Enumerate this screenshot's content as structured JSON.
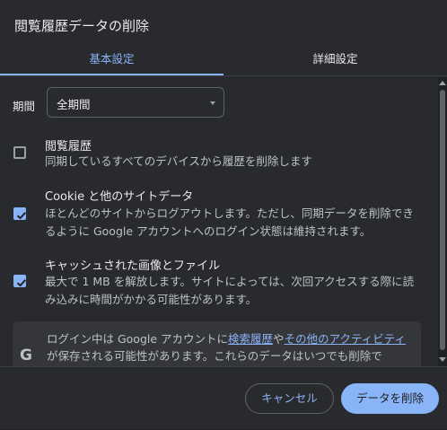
{
  "dialog": {
    "title": "閲覧履歴データの削除",
    "tabs": {
      "basic": "基本設定",
      "advanced": "詳細設定"
    },
    "time_range": {
      "label": "期間",
      "value": "全期間"
    },
    "items": [
      {
        "title": "閲覧履歴",
        "description": "同期しているすべてのデバイスから履歴を削除します",
        "checked": false
      },
      {
        "title": "Cookie と他のサイトデータ",
        "description": "ほとんどのサイトからログアウトします。ただし、同期データを削除できるように Google アカウントへのログイン状態は維持されます。",
        "checked": true
      },
      {
        "title": "キャッシュされた画像とファイル",
        "description": "最大で 1 MB を解放します。サイトによっては、次回アクセスする際に読み込みに時間がかかる可能性があります。",
        "checked": true
      }
    ],
    "google_notice": {
      "icon": "G",
      "text_before": "ログイン中は Google アカウントに",
      "link1": "検索履歴",
      "text_middle": "や",
      "link2": "その他のアクティビティ",
      "text_after": "が保存される可能性があります。これらのデータはいつでも削除で"
    },
    "buttons": {
      "cancel": "キャンセル",
      "delete": "データを削除"
    }
  },
  "colors": {
    "accent": "#8ab4f8",
    "background": "#292a2d"
  }
}
